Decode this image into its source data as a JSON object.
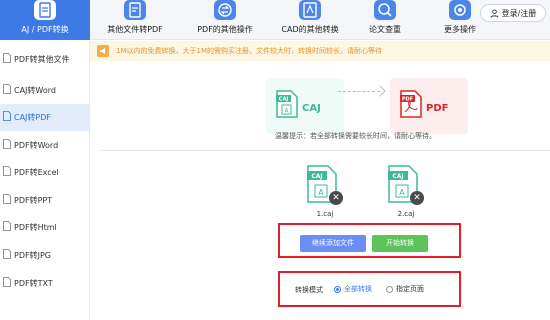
{
  "toolbar": {
    "items": [
      {
        "label": "AJ / PDF转换",
        "icon": "pdf-convert-icon"
      },
      {
        "label": "其他文件转PDF",
        "icon": "file-to-pdf-icon"
      },
      {
        "label": "PDF的其他操作",
        "icon": "pdf-operations-icon"
      },
      {
        "label": "CAD的其他转换",
        "icon": "cad-convert-icon"
      },
      {
        "label": "论文查重",
        "icon": "paper-check-icon"
      },
      {
        "label": "更多操作",
        "icon": "more-settings-icon"
      }
    ],
    "login_label": "登录/注册"
  },
  "notice": {
    "text": "1M以内的免费转换，大于1M的需购买注册。文件较大时，转换时间较长，请耐心等待",
    "icon": "notice-speaker-icon"
  },
  "sidebar": {
    "items": [
      {
        "label": "PDF转其他文件",
        "active": false
      },
      {
        "label": "CAJ转Word",
        "active": false
      },
      {
        "label": "CAJ转PDF",
        "active": true
      },
      {
        "label": "PDF转Word",
        "active": false
      },
      {
        "label": "PDF转Excel",
        "active": false
      },
      {
        "label": "PDF转PPT",
        "active": false
      },
      {
        "label": "PDF转Html",
        "active": false
      },
      {
        "label": "PDF转JPG",
        "active": false
      },
      {
        "label": "PDF转TXT",
        "active": false
      }
    ]
  },
  "conversion": {
    "from": "CAJ",
    "to": "PDF",
    "tip": "温馨提示：若全部转换需要较长时间，请耐心等待。"
  },
  "files": [
    {
      "name": "1.caj",
      "badge": "CAJ"
    },
    {
      "name": "2.caj",
      "badge": "CAJ"
    }
  ],
  "actions": {
    "add_label": "继续添加文件",
    "start_label": "开始转换"
  },
  "mode": {
    "label": "转换模式",
    "options": [
      "全部转换",
      "指定页面"
    ],
    "selected": "全部转换"
  },
  "colors": {
    "accent": "#3d7ae6",
    "caj": "#3db89b",
    "pdf": "#d8262b",
    "notice": "#e8932a",
    "highlight_frame": "#e01f26",
    "add_button": "#6a8ef3",
    "start_button": "#5cc25a"
  }
}
